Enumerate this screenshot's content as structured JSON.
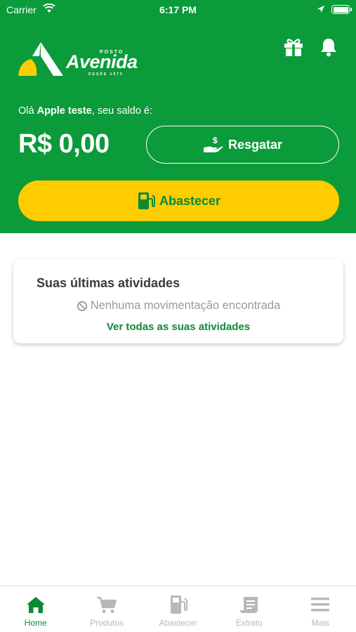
{
  "status_bar": {
    "carrier": "Carrier",
    "time": "6:17 PM"
  },
  "logo": {
    "prefix": "POSTO",
    "brand": "Avenida",
    "since": "DESDE 1973"
  },
  "header": {
    "greeting_prefix": "Olá ",
    "user_name": "Apple teste",
    "greeting_suffix": ", seu saldo é:",
    "balance": "R$ 0,00",
    "redeem_label": "Resgatar",
    "fuel_label": "Abastecer"
  },
  "activities": {
    "title": "Suas últimas atividades",
    "empty_message": "Nenhuma movimentação encontrada",
    "see_all": "Ver todas as suas atividades"
  },
  "tabbar": {
    "items": [
      {
        "label": "Home",
        "icon": "home-icon",
        "active": true
      },
      {
        "label": "Produtos",
        "icon": "cart-icon",
        "active": false
      },
      {
        "label": "Abastecer",
        "icon": "fuel-pump-icon",
        "active": false
      },
      {
        "label": "Extrato",
        "icon": "receipt-icon",
        "active": false
      },
      {
        "label": "Mais",
        "icon": "menu-icon",
        "active": false
      }
    ]
  },
  "colors": {
    "brand_green": "#0b9b3a",
    "accent_yellow": "#ffcc00",
    "text_green": "#0b8a36"
  }
}
